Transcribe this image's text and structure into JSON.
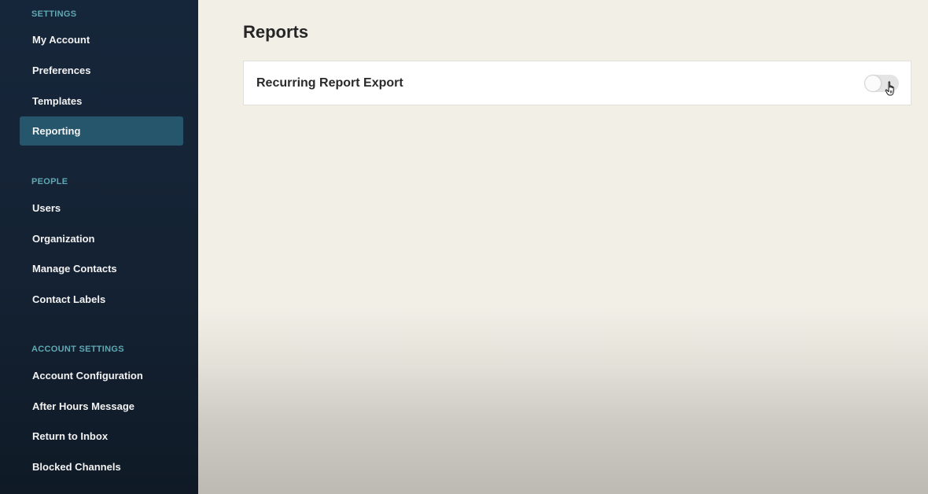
{
  "sidebar": {
    "sections": [
      {
        "heading": "SETTINGS",
        "items": [
          {
            "label": "My Account"
          },
          {
            "label": "Preferences"
          },
          {
            "label": "Templates"
          },
          {
            "label": "Reporting",
            "active": true
          }
        ]
      },
      {
        "heading": "PEOPLE",
        "items": [
          {
            "label": "Users"
          },
          {
            "label": "Organization"
          },
          {
            "label": "Manage Contacts"
          },
          {
            "label": "Contact Labels"
          }
        ]
      },
      {
        "heading": "ACCOUNT SETTINGS",
        "items": [
          {
            "label": "Account Configuration"
          },
          {
            "label": "After Hours Message"
          },
          {
            "label": "Return to Inbox"
          },
          {
            "label": "Blocked Channels"
          }
        ]
      }
    ]
  },
  "main": {
    "title": "Reports",
    "settings": [
      {
        "label": "Recurring Report Export",
        "enabled": false
      }
    ]
  },
  "icons": {
    "toggle_cursor": "hand-pointer-icon"
  },
  "colors": {
    "sidebar_bg": "#16263a",
    "active_item_bg": "#25566b",
    "section_heading": "#5fa9b5",
    "main_bg": "#f2efe7"
  }
}
